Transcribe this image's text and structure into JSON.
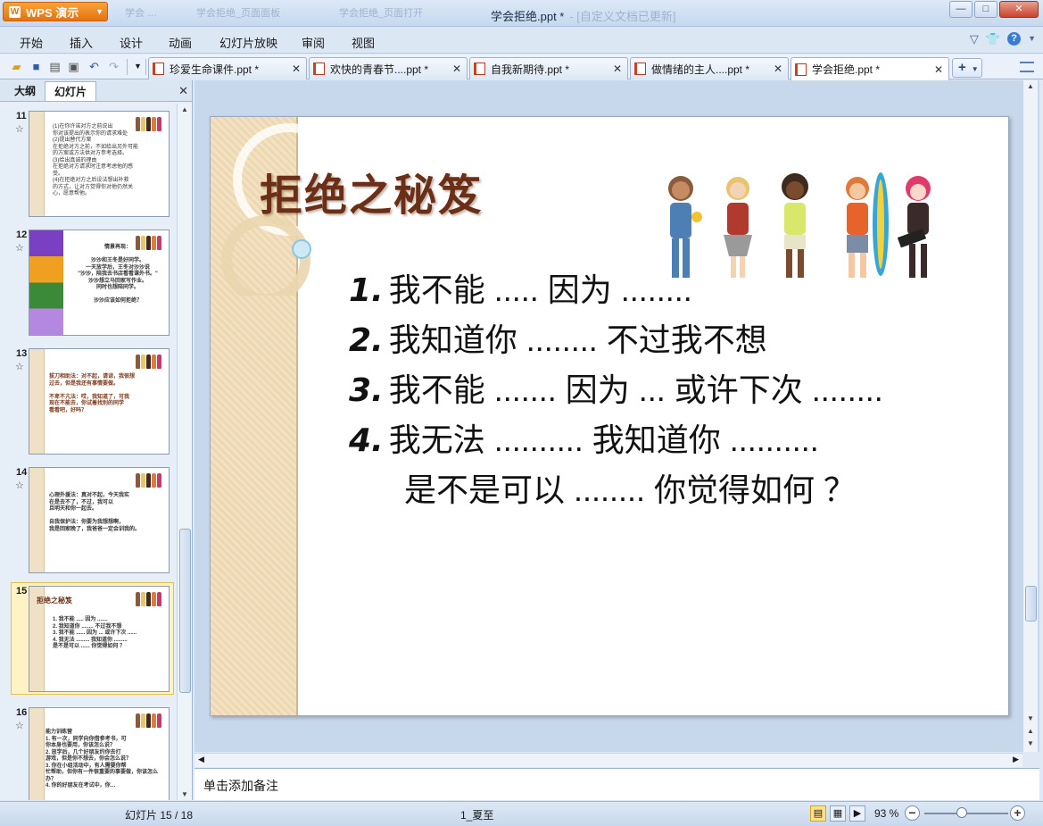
{
  "app": {
    "menu_label": "WPS 演示",
    "window_title": "学会拒绝.ppt *",
    "window_title_ghost": "- [自定义文档已更新]",
    "ghost_tabs": [
      "学会 …",
      "学会拒绝_页面面板",
      "学会拒绝_页面打开"
    ]
  },
  "window_controls": {
    "minimize": "—",
    "maximize": "□",
    "close": "✕"
  },
  "menu": {
    "items": [
      "开始",
      "插入",
      "设计",
      "动画",
      "幻灯片放映",
      "审阅",
      "视图"
    ],
    "right_icons": [
      "filter-icon",
      "skin-icon",
      "help-icon"
    ],
    "help_glyph": "?"
  },
  "toolbar": {
    "icons": [
      "open-folder-icon",
      "save-icon",
      "print-icon",
      "print-preview-icon",
      "undo-icon",
      "redo-icon",
      "customize-icon"
    ]
  },
  "doc_tabs": [
    {
      "label": "珍爱生命课件.ppt *",
      "active": false
    },
    {
      "label": "欢快的青春节....ppt *",
      "active": false
    },
    {
      "label": "自我新期待.ppt *",
      "active": false
    },
    {
      "label": "做情绪的主人....ppt *",
      "active": false
    },
    {
      "label": "学会拒绝.ppt *",
      "active": true
    }
  ],
  "left_panel": {
    "tabs": [
      "大纲",
      "幻灯片"
    ],
    "active_tab": "幻灯片",
    "close_glyph": "✕",
    "thumbnails": [
      {
        "number": "11",
        "star": "☆",
        "text": "(1)在你许诺对方之前说出\n你对该提出的表示你的请求难处\n(2)提出替代方案\n在拒绝对方之前，不如给出另外可能\n的方案或方法供对方参考选择。\n(3)给出真诚的理由\n在拒绝对方请求时注意考虑他的感\n受。\n(4)在拒绝对方之后设法想出补救\n的方式，让对方觉得你对他仍然关\n心，愿意帮他。"
      },
      {
        "number": "12",
        "star": "☆",
        "text": "情景再现：\n\n沙沙和王冬是好同学。\n一天放学后，王冬对沙沙说\n\"沙沙，陪我去书店看看课外书。\"\n沙沙想立马回家写作业。\n同时也想陪同学。\n\n沙沙应该如何拒绝？"
      },
      {
        "number": "13",
        "star": "☆",
        "text": "拔刀相助法：对不起，请谅，我很想\n过去，但是我还有事情要做。\n\n不卑不亢法：哎，我知道了，可我\n现在不能去，你试着找别的同学\n看看吧，好吗？"
      },
      {
        "number": "14",
        "star": "☆",
        "text": "心理外援法：真对不起，今天我实\n在是去不了，不过，我可以\n且明天和你一起去。\n\n自我保护法：你要为我想想啊，\n我是回家晚了，我爸爸一定会训我的。"
      },
      {
        "number": "15",
        "star": "",
        "title": "拒绝之秘笈",
        "text": "1. 我不能 ..... 因为 .......\n2. 我知道你 ........ 不过我不想\n3. 我不能 ...... 因为 ... 或许下次 ......\n4. 我无法 ......... 我知道你 .........\n    是不是可以 ...... 你觉得如何 ？",
        "selected": true
      },
      {
        "number": "16",
        "star": "☆",
        "text": "能力训练营\n1. 有一次，同学向你借参考书，可\n你本身也要用，你该怎么说？\n2. 放学后，几个好朋友约你去打\n游戏，但是你不想去，你会怎么说？\n3. 你在小组活动中，有人需要你帮\n忙帮助，但你有一件很重要的事要做，你该怎么办？\n4. 你的好朋友在考试中，你…"
      }
    ]
  },
  "slide": {
    "title": "拒绝之秘笈",
    "lines": [
      {
        "num": "1.",
        "text": "我不能 ..... 因为 ........"
      },
      {
        "num": "2.",
        "text": "我知道你 ........ 不过我不想"
      },
      {
        "num": "3.",
        "text": "我不能 ....... 因为 ... 或许下次 ........"
      },
      {
        "num": "4.",
        "text": "我无法 .......... 我知道你 .........."
      },
      {
        "num": "",
        "text": "是不是可以 ........ 你觉得如何 ？"
      }
    ]
  },
  "notes": {
    "placeholder": "单击添加备注"
  },
  "status": {
    "slide_counter": "幻灯片 15 / 18",
    "theme_name": "1_夏至",
    "zoom": "93 %",
    "zoom_minus": "−",
    "zoom_plus": "+",
    "zoom_level_fraction": 0.45
  }
}
